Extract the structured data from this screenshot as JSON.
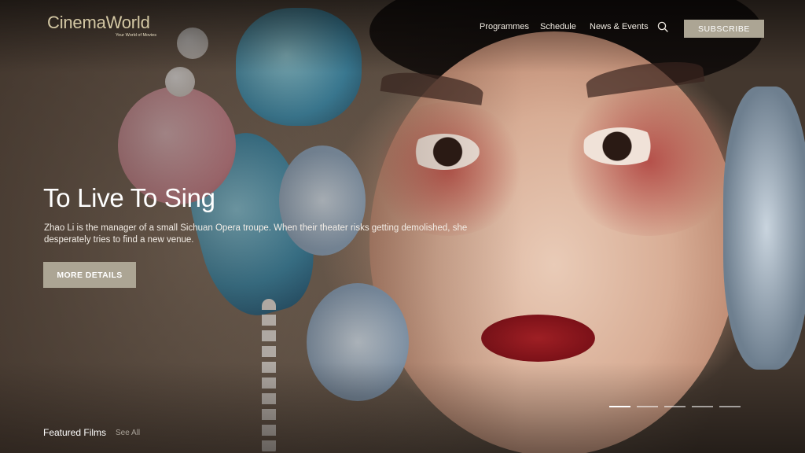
{
  "header": {
    "logo_name": "CinemaWorld",
    "logo_tagline": "Your World of Movies",
    "nav": [
      "Programmes",
      "Schedule",
      "News & Events"
    ],
    "search_icon": "search-icon",
    "subscribe_label": "SUBSCRIBE"
  },
  "hero": {
    "title": "To Live To Sing",
    "description": "Zhao Li is the manager of a small Sichuan Opera troupe. When their theater risks getting demolished, she desperately tries to find a new venue.",
    "cta_label": "MORE DETAILS"
  },
  "carousel": {
    "slide_count": 5,
    "active_index": 0
  },
  "featured": {
    "title": "Featured Films",
    "see_all_label": "See All"
  },
  "colors": {
    "accent_button": "#aca594",
    "logo": "#d4c8a4"
  }
}
